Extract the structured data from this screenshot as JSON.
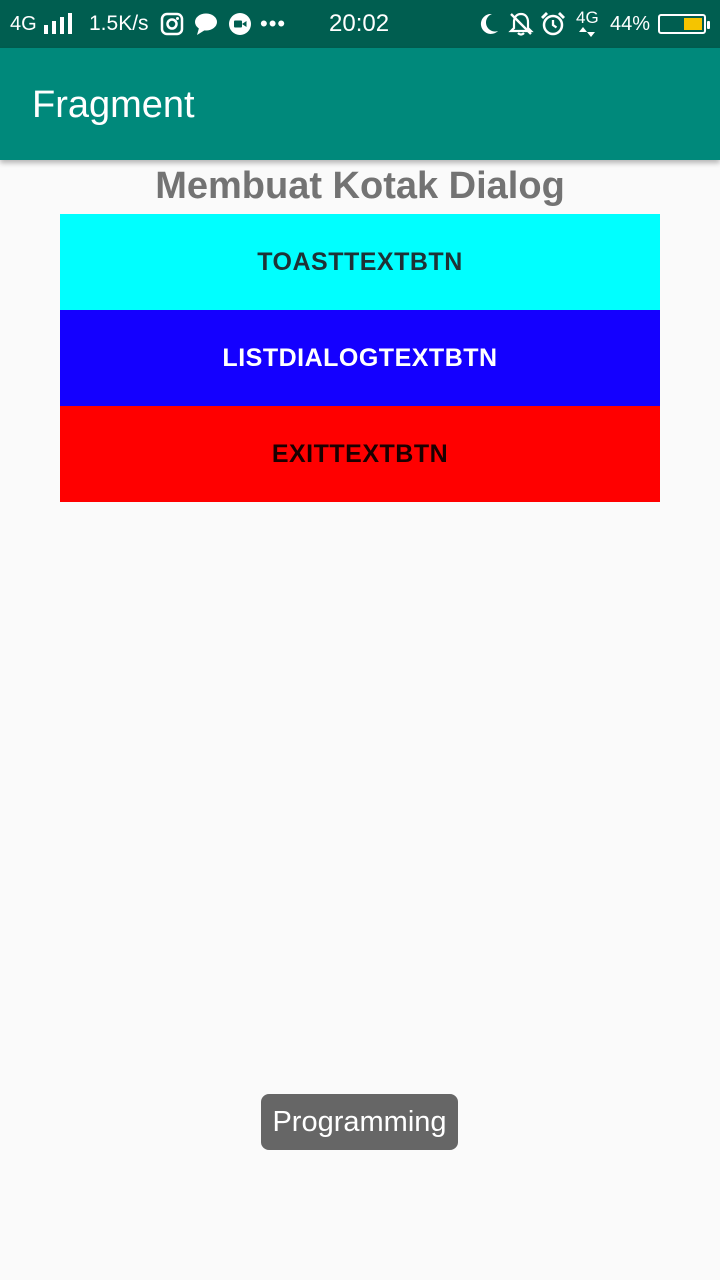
{
  "status_bar": {
    "network": "4G",
    "speed": "1.5K/s",
    "more": "•••",
    "time": "20:02",
    "network2": "4G",
    "battery_percent": "44%",
    "battery_level": 0.44,
    "icons": [
      "signal-bars-icon",
      "instagram-icon",
      "chat-bubble-icon",
      "video-call-icon",
      "moon-icon",
      "mute-bell-icon",
      "alarm-clock-icon",
      "battery-icon"
    ]
  },
  "app_bar": {
    "title": "Fragment"
  },
  "content": {
    "heading": "Membuat Kotak Dialog",
    "buttons": [
      {
        "label": "TOASTTEXTBTN",
        "color": "#00ffff"
      },
      {
        "label": "LISTDIALOGTEXTBTN",
        "color": "#1400ff"
      },
      {
        "label": "EXITTEXTBTN",
        "color": "#ff0000"
      }
    ]
  },
  "toast": {
    "text": "Programming"
  }
}
